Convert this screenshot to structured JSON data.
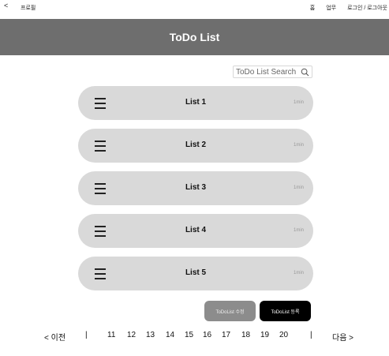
{
  "topnav": {
    "back_glyph": "<",
    "profile": "프로필",
    "links": [
      "홈",
      "업무",
      "로그인 / 로그아웃"
    ]
  },
  "header": {
    "title": "ToDo List"
  },
  "search": {
    "placeholder": "ToDo List Search",
    "icon": "search-icon"
  },
  "todos": [
    {
      "label": "List 1",
      "time": "1min"
    },
    {
      "label": "List 2",
      "time": "1min"
    },
    {
      "label": "List 3",
      "time": "1min"
    },
    {
      "label": "List 4",
      "time": "1min"
    },
    {
      "label": "List 5",
      "time": "1min"
    }
  ],
  "buttons": {
    "edit": "ToDoList 수정",
    "add": "ToDoList 등록"
  },
  "pagination": {
    "prev": "< 이전",
    "next": "다음 >",
    "separator": "|",
    "pages": [
      "11",
      "12",
      "13",
      "14",
      "15",
      "16",
      "17",
      "18",
      "19",
      "20"
    ]
  },
  "colors": {
    "header_bg": "#6e6e6e",
    "item_bg": "#d9d9d9",
    "edit_btn": "#8c8c8c",
    "add_btn": "#000000"
  }
}
